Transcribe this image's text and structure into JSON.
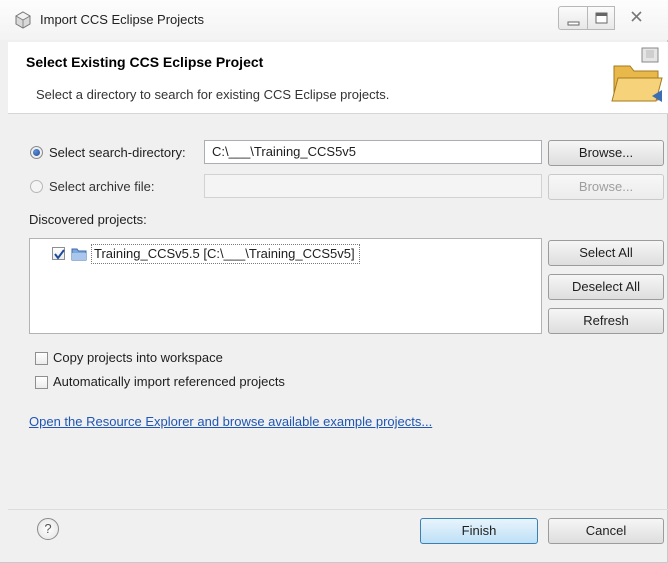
{
  "window": {
    "title": "Import CCS Eclipse Projects"
  },
  "banner": {
    "title": "Select Existing CCS Eclipse Project",
    "description": "Select a directory to search for existing CCS Eclipse projects."
  },
  "search_directory": {
    "label": "Select search-directory:",
    "value": "C:\\___\\Training_CCS5v5",
    "browse_label": "Browse...",
    "selected": true
  },
  "archive_file": {
    "label": "Select archive file:",
    "value": "",
    "browse_label": "Browse...",
    "selected": false
  },
  "discovered": {
    "label": "Discovered projects:",
    "projects": [
      {
        "name": "Training_CCSv5.5  [C:\\___\\Training_CCS5v5]",
        "checked": true
      }
    ],
    "select_all_label": "Select All",
    "deselect_all_label": "Deselect All",
    "refresh_label": "Refresh"
  },
  "options": {
    "copy_projects_label": "Copy projects into workspace",
    "copy_projects_checked": false,
    "auto_import_label": "Automatically import referenced projects",
    "auto_import_checked": false
  },
  "resource_link": "Open the Resource Explorer and browse available example projects...",
  "footer": {
    "help_glyph": "?",
    "finish_label": "Finish",
    "cancel_label": "Cancel"
  },
  "icons": {
    "app": "eclipse-cube-icon",
    "banner": "folder-open-icon",
    "project": "folder-icon",
    "help": "help-icon"
  },
  "colors": {
    "accent_link": "#1f56b3",
    "default_button": "#bee0f6",
    "radio_selected": "#1e4c9a"
  }
}
